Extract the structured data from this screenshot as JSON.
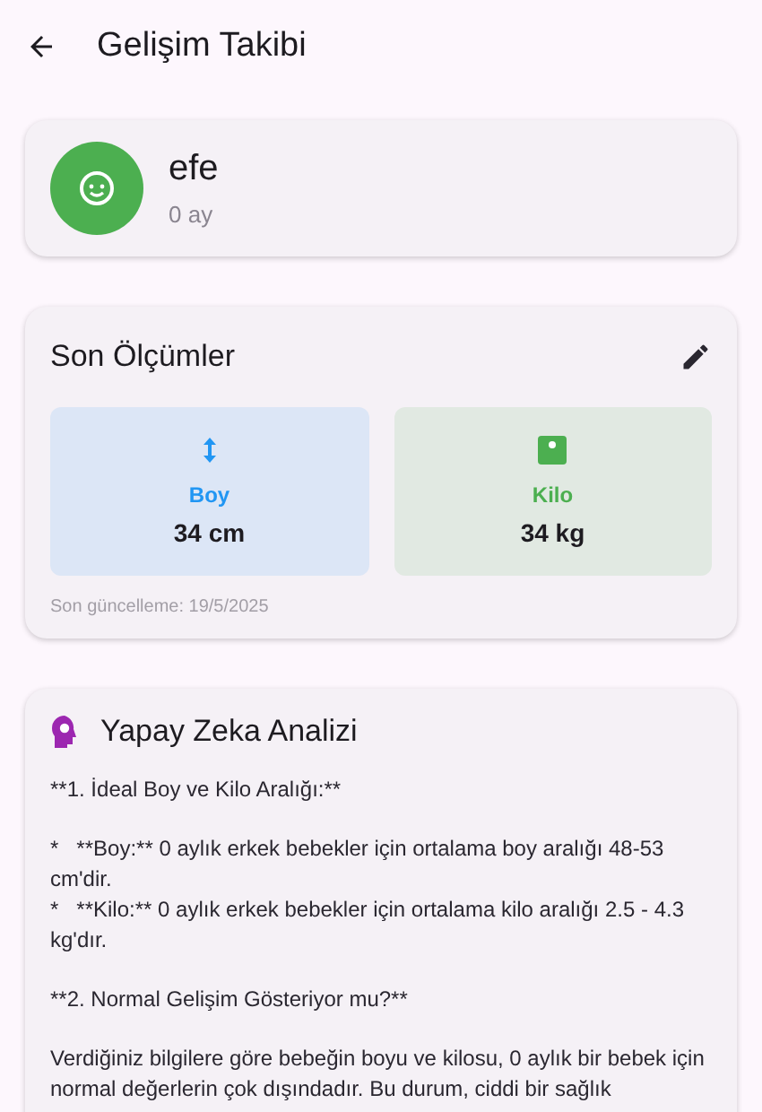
{
  "app_bar": {
    "title": "Gelişim Takibi"
  },
  "profile": {
    "name": "efe",
    "age": "0 ay"
  },
  "measurements": {
    "title": "Son Ölçümler",
    "items": [
      {
        "kind": "height",
        "label": "Boy",
        "value": "34 cm",
        "color": "#2196f3"
      },
      {
        "kind": "weight",
        "label": "Kilo",
        "value": "34 kg",
        "color": "#4caf50"
      }
    ],
    "updated": "Son güncelleme: 19/5/2025"
  },
  "analysis": {
    "title": "Yapay Zeka Analizi",
    "paragraphs": [
      [
        "**1. İdeal Boy ve Kilo Aralığı:**"
      ],
      [
        "*   **Boy:** 0 aylık erkek bebekler için ortalama boy aralığı 48-53 cm'dir.",
        "*   **Kilo:** 0 aylık erkek bebekler için ortalama kilo aralığı 2.5 - 4.3 kg'dır."
      ],
      [
        "**2. Normal Gelişim Gösteriyor mu?**"
      ],
      [
        "Verdiğiniz bilgilere göre bebeğin boyu ve kilosu, 0 aylık bir bebek için normal değerlerin çok dışındadır. Bu durum, ciddi bir sağlık"
      ]
    ]
  }
}
